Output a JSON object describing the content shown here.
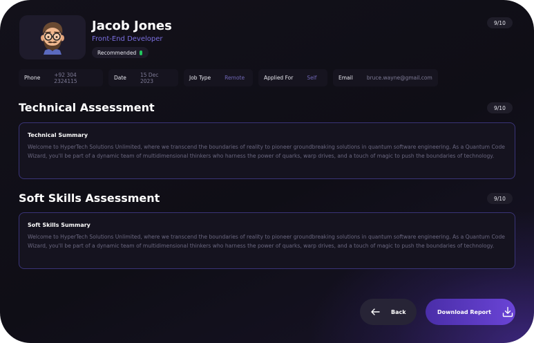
{
  "candidate": {
    "name": "Jacob Jones",
    "role": "Front-End Developer",
    "badge": "Recommended",
    "overall_score": "9/10",
    "avatar_icon": "memoji-avatar-icon"
  },
  "info": {
    "phone_label": "Phone",
    "phone_value": "+92 304 2324115",
    "date_label": "Date",
    "date_value": "15 Dec 2023",
    "job_type_label": "Job Type",
    "job_type_value": "Remote",
    "applied_for_label": "Applied For",
    "applied_for_value": "Self",
    "email_label": "Email",
    "email_value": "bruce.wayne@gmail.com"
  },
  "technical": {
    "title": "Technical Assessment",
    "score": "9/10",
    "summary_title": "Technical Summary",
    "summary_text": "Welcome to HyperTech Solutions Unlimited, where we transcend the boundaries of reality to pioneer groundbreaking solutions in quantum software engineering. As a Quantum Code Wizard, you'll be part of a dynamic team of multidimensional thinkers who harness the power of quarks, warp drives, and a touch of magic to push the boundaries of technology."
  },
  "soft_skills": {
    "title": "Soft Skills Assessment",
    "score": "9/10",
    "summary_title": "Soft Skills Summary",
    "summary_text": "Welcome to HyperTech Solutions Unlimited, where we transcend the boundaries of reality to pioneer groundbreaking solutions in quantum software engineering. As a Quantum Code Wizard, you'll be part of a dynamic team of multidimensional thinkers who harness the power of quarks, warp drives, and a touch of magic to push the boundaries of technology."
  },
  "actions": {
    "back_label": "Back",
    "download_label": "Download Report"
  },
  "colors": {
    "accent": "#6a44d6",
    "role_text": "#7b6fe0",
    "status_green": "#22c55e",
    "box_border": "#3a3478"
  }
}
